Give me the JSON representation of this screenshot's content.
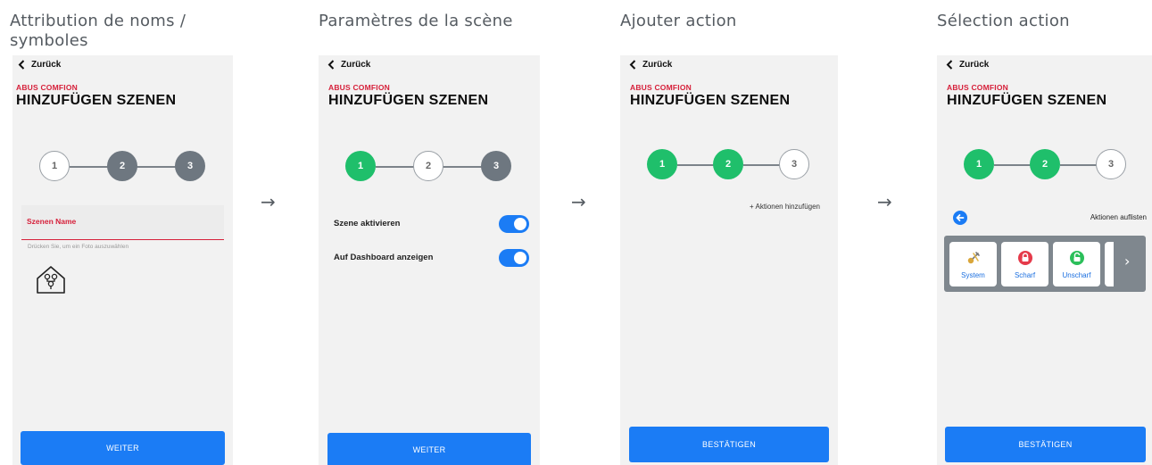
{
  "captions": [
    "Attribution de noms / symboles",
    "Paramètres de la scène",
    "Ajouter action",
    "Sélection action"
  ],
  "arrow_glyph": "→",
  "common": {
    "back_label": "Zurück",
    "brand": "ABUS COMFION",
    "title": "HINZUFÜGEN SZENEN",
    "steps": [
      "1",
      "2",
      "3"
    ]
  },
  "screen1": {
    "field_label": "Szenen Name",
    "photo_hint": "Drücken Sie, um ein Foto auszuwählen",
    "button": "WEITER"
  },
  "screen2": {
    "toggles": [
      {
        "label": "Szene aktivieren",
        "on": true
      },
      {
        "label": "Auf Dashboard anzeigen",
        "on": true
      }
    ],
    "button": "WEITER"
  },
  "screen3": {
    "add_action": "+ Aktionen hinzufügen",
    "button": "BESTÄTIGEN"
  },
  "screen4": {
    "list_actions": "Aktionen auflisten",
    "tiles": [
      {
        "label": "System",
        "icon": "tools-icon"
      },
      {
        "label": "Scharf",
        "icon": "lock-icon"
      },
      {
        "label": "Unscharf",
        "icon": "unlock-icon"
      }
    ],
    "next_glyph": "›",
    "button": "BESTÄTIGEN"
  },
  "colors": {
    "accent_blue": "#1b7cf5",
    "brand_red": "#d6203a",
    "step_done": "#1fbf6b",
    "step_pending": "#6e7780",
    "unlock_green": "#2bbf5a"
  }
}
